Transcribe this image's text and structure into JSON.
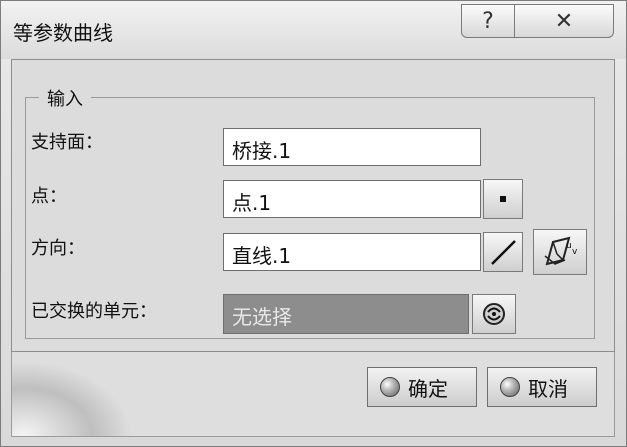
{
  "window": {
    "title": "等参数曲线",
    "help_glyph": "?",
    "close_glyph": "✕"
  },
  "group": {
    "label": "输入"
  },
  "fields": {
    "support": {
      "label": "支持面：",
      "value": "桥接.1"
    },
    "point": {
      "label": "点：",
      "value": "点.1"
    },
    "direction": {
      "label": "方向：",
      "value": "直线.1"
    },
    "swapped": {
      "label": "已交换的单元：",
      "value": "无选择"
    }
  },
  "buttons": {
    "ok_label": "确定",
    "cancel_label": "取消"
  },
  "icons": {
    "point_button": "point-icon",
    "line_button": "line-icon",
    "compass_button": "compass-icon",
    "swap_button": "swap-cells-icon"
  }
}
